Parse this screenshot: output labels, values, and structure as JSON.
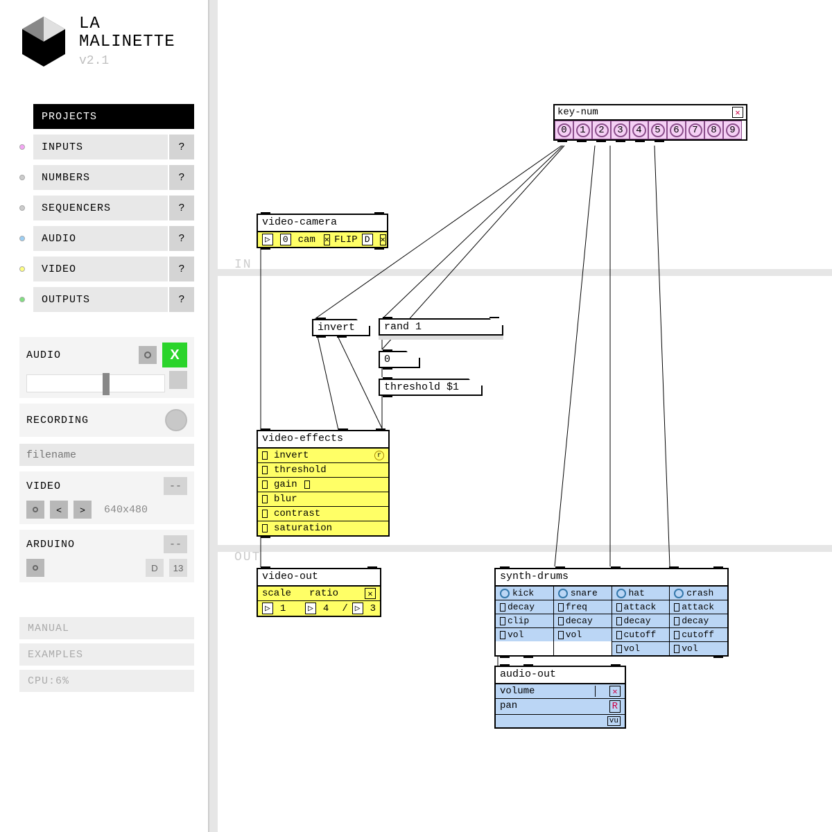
{
  "app": {
    "title1": "LA",
    "title2": "MALINETTE",
    "version": "v2.1"
  },
  "menu": {
    "projects": "PROJECTS",
    "items": [
      {
        "label": "INPUTS",
        "dot": "#f5a5f5"
      },
      {
        "label": "NUMBERS",
        "dot": "#cccccc"
      },
      {
        "label": "SEQUENCERS",
        "dot": "#cccccc"
      },
      {
        "label": "AUDIO",
        "dot": "#9bcff5"
      },
      {
        "label": "VIDEO",
        "dot": "#ffff80"
      },
      {
        "label": "OUTPUTS",
        "dot": "#80e080"
      }
    ],
    "help": "?"
  },
  "audio_panel": {
    "title": "AUDIO",
    "close": "X"
  },
  "recording_panel": {
    "title": "RECORDING",
    "placeholder": "filename"
  },
  "video_panel": {
    "title": "VIDEO",
    "dash": "--",
    "res": "640x480"
  },
  "arduino_panel": {
    "title": "ARDUINO",
    "dash": "--",
    "d": "D",
    "pin": "13"
  },
  "bottom": {
    "manual": "MANUAL",
    "examples": "EXAMPLES",
    "cpu": "CPU:6%"
  },
  "band": {
    "in": "IN",
    "out": "OUT"
  },
  "keynum": {
    "title": "key-num",
    "keys": [
      "0",
      "1",
      "2",
      "3",
      "4",
      "5",
      "6",
      "7",
      "8",
      "9"
    ]
  },
  "vcam": {
    "title": "video-camera",
    "zero": "0",
    "cam": "cam",
    "flip": "FLIP",
    "d": "D"
  },
  "invert_box": "invert",
  "rand_box": "rand 1",
  "zero_box": "0",
  "thresh_box": "threshold $1",
  "veffects": {
    "title": "video-effects",
    "rows": [
      "invert",
      "threshold",
      "gain",
      "blur",
      "contrast",
      "saturation"
    ]
  },
  "vout": {
    "title": "video-out",
    "scale": "scale",
    "ratio": "ratio",
    "a": "1",
    "b": "4",
    "slash": "/",
    "c": "3"
  },
  "drums": {
    "title": "synth-drums",
    "cols": [
      {
        "head": "kick",
        "rows": [
          "decay",
          "clip",
          "vol"
        ]
      },
      {
        "head": "snare",
        "rows": [
          "freq",
          "decay",
          "vol"
        ]
      },
      {
        "head": "hat",
        "rows": [
          "attack",
          "decay",
          "cutoff",
          "vol"
        ]
      },
      {
        "head": "crash",
        "rows": [
          "attack",
          "decay",
          "cutoff",
          "vol"
        ]
      }
    ]
  },
  "aout": {
    "title": "audio-out",
    "rows": [
      "volume",
      "pan"
    ],
    "r": "R",
    "vu": "vu"
  }
}
